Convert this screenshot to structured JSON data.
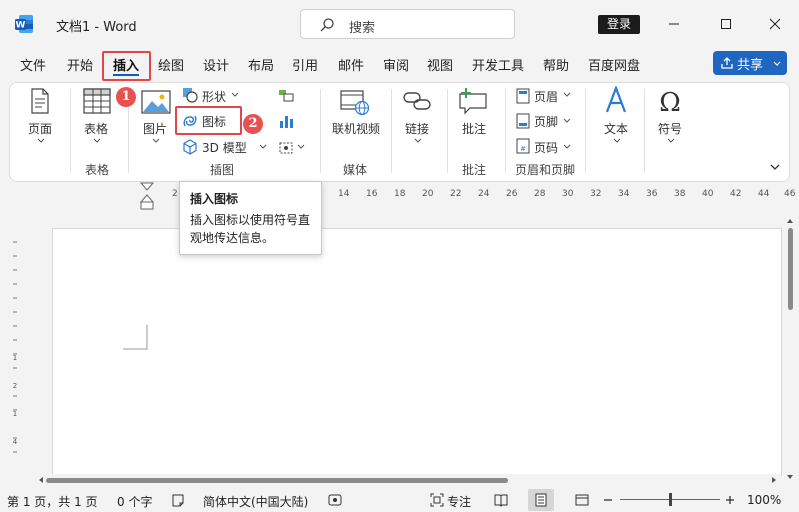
{
  "title": "文档1  -  Word",
  "search": {
    "placeholder": "搜索"
  },
  "account": {
    "login_label": "登录"
  },
  "menu": {
    "items": [
      "文件",
      "开始",
      "插入",
      "绘图",
      "设计",
      "布局",
      "引用",
      "邮件",
      "审阅",
      "视图",
      "开发工具",
      "帮助",
      "百度网盘"
    ],
    "active": "插入",
    "share_label": "共享"
  },
  "ribbon": {
    "pages": {
      "label": "页面"
    },
    "tables": {
      "label": "表格",
      "group": "表格"
    },
    "illustrations": {
      "group": "插图",
      "pictures": "图片",
      "shapes": "形状",
      "icons": "图标",
      "models3d": "3D 模型"
    },
    "media": {
      "group": "媒体",
      "online_video": "联机视频"
    },
    "links": {
      "label": "链接"
    },
    "comments": {
      "label": "批注",
      "group": "批注"
    },
    "header_footer": {
      "group": "页眉和页脚",
      "header": "页眉",
      "footer": "页脚",
      "page_number": "页码"
    },
    "text": {
      "label": "文本"
    },
    "symbols": {
      "label": "符号"
    }
  },
  "callouts": {
    "step1": "1",
    "step2": "2"
  },
  "ruler": {
    "ticks": [
      "2",
      "14",
      "16",
      "18",
      "20",
      "22",
      "24",
      "26",
      "28",
      "30",
      "32",
      "34",
      "36",
      "38",
      "40",
      "42",
      "44",
      "46"
    ]
  },
  "vruler": {
    "ticks": [
      "1",
      "2",
      "1",
      "4"
    ]
  },
  "tooltip": {
    "title": "插入图标",
    "body": "插入图标以使用符号直观地传达信息。"
  },
  "status": {
    "page": "第 1 页，共 1 页",
    "words": "0 个字",
    "language": "简体中文(中国大陆)",
    "focus": "专注",
    "zoom": "100%"
  },
  "colors": {
    "accent": "#185abd",
    "highlight": "#e0474c",
    "badge": "#e8514f"
  }
}
